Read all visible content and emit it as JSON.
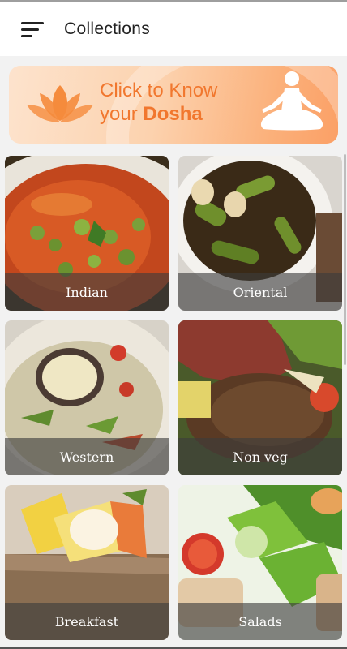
{
  "appbar": {
    "title": "Collections",
    "menu_icon": "hamburger-menu-icon"
  },
  "banner": {
    "line1": "Click to Know",
    "line2_prefix": "your ",
    "line2_bold": "Dosha",
    "colors": {
      "accent": "#f1772e",
      "bg_light": "#fde3cd",
      "bg_dark": "#fba066"
    }
  },
  "collections": [
    {
      "label": "Indian"
    },
    {
      "label": "Oriental"
    },
    {
      "label": "Western"
    },
    {
      "label": "Non veg"
    },
    {
      "label": "Breakfast"
    },
    {
      "label": "Salads"
    }
  ]
}
